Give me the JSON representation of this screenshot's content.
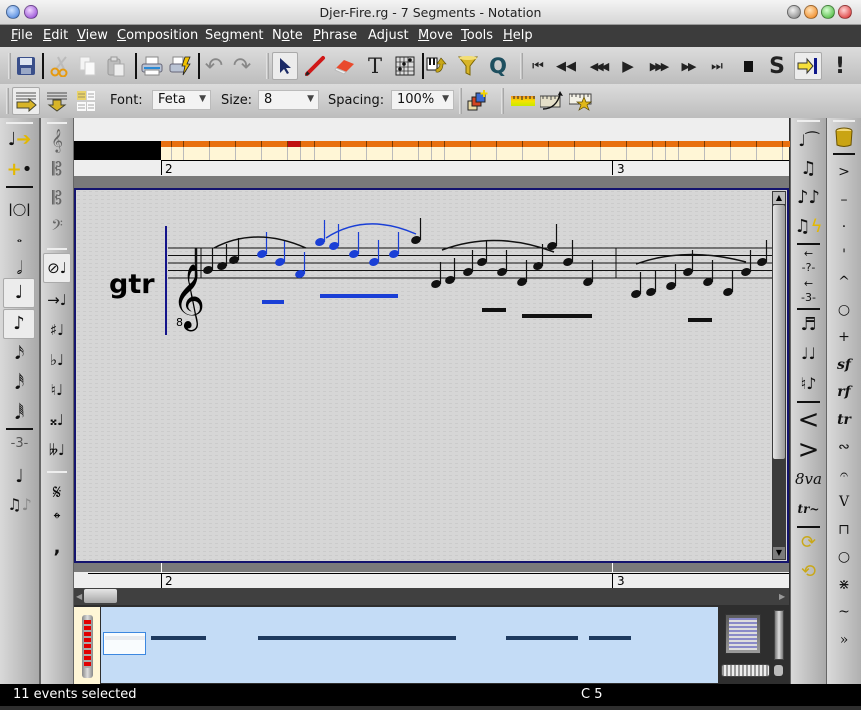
{
  "window": {
    "title": "Djer-Fire.rg - 7 Segments - Notation"
  },
  "menubar": {
    "items": [
      {
        "label": "File",
        "u": "F",
        "rest": "ile"
      },
      {
        "label": "Edit",
        "u": "E",
        "rest": "dit"
      },
      {
        "label": "View",
        "u": "V",
        "rest": "iew"
      },
      {
        "label": "Composition",
        "u": "C",
        "rest": "omposition"
      },
      {
        "label": "Segment",
        "pre": "Se",
        "u": "g",
        "rest": "ment"
      },
      {
        "label": "Note",
        "pre": "N",
        "u": "o",
        "rest": "te"
      },
      {
        "label": "Phrase",
        "u": "P",
        "rest": "hrase"
      },
      {
        "label": "Adjust",
        "pre": "Ad",
        "u": "j",
        "rest": "ust"
      },
      {
        "label": "Move",
        "u": "M",
        "rest": "ove"
      },
      {
        "label": "Tools",
        "u": "T",
        "rest": "ools"
      },
      {
        "label": "Help",
        "u": "H",
        "rest": "elp"
      }
    ]
  },
  "toolbar1": {
    "file": [
      "save-icon"
    ],
    "edit": [
      "cut-icon",
      "copy-icon",
      "paste-icon"
    ],
    "print": [
      "print-icon",
      "print-preview-icon"
    ],
    "history": [
      "undo-icon",
      "redo-icon"
    ],
    "tools": [
      "select-pointer-icon",
      "pencil-draw-icon",
      "eraser-icon",
      "text-tool-icon",
      "guitar-chord-icon",
      "insert-note-piano-icon",
      "filter-funnel-icon"
    ],
    "quantize_label": "Q",
    "transport": [
      "rewind-to-start-icon",
      "rewind-icon",
      "fast-rewind-icon",
      "play-icon",
      "fast-forward-icon",
      "forward-icon",
      "skip-to-end-icon",
      "stop-icon"
    ],
    "solo_label": "S",
    "panic_label": "!"
  },
  "toolbar2": {
    "font_label": "Font:",
    "font_value": "Feta",
    "size_label": "Size:",
    "size_value": "8",
    "spacing_label": "Spacing:",
    "spacing_value": "100%"
  },
  "palettes": {
    "durations": {
      "triplet_label": "-3-"
    },
    "right_actions": {
      "triplet_label": "-3-",
      "tuplet_label": "-?-",
      "ottava_label": "8va",
      "trill_label": "tr~"
    },
    "marks": {
      "items": [
        ">",
        "–",
        "·",
        "'",
        "^",
        "○",
        "+",
        "sf",
        "rf",
        "tr",
        "∾",
        "𝄐",
        "V",
        "⊓",
        "○",
        "⋇",
        "~",
        "»"
      ]
    }
  },
  "ruler": {
    "bar_numbers": [
      "2",
      "3"
    ]
  },
  "score": {
    "staff_label": "gtr",
    "clef": "treble-8vb",
    "clef_octave": "8",
    "selection_color": "#1a3fd6"
  },
  "status": {
    "selection_text": "11 events selected",
    "pitch_text": "C 5"
  }
}
